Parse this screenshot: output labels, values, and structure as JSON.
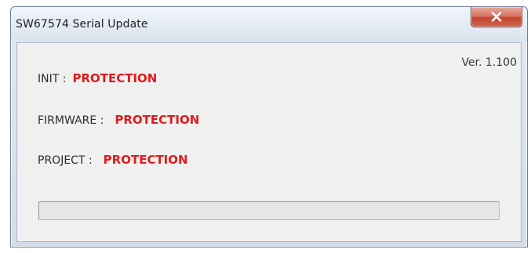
{
  "window": {
    "title": "SW67574 Serial Update",
    "close_symbol": "✕"
  },
  "version": "Ver. 1.100",
  "rows": [
    {
      "label": "INIT :",
      "status": "PROTECTION"
    },
    {
      "label": "FIRMWARE :",
      "status": "PROTECTION"
    },
    {
      "label": "PROJECT :",
      "status": "PROTECTION"
    }
  ],
  "progress": {
    "value": 0
  },
  "colors": {
    "status": "#e21b1b",
    "close_button": "#c1452f"
  },
  "icons": {
    "close": "close-icon"
  }
}
